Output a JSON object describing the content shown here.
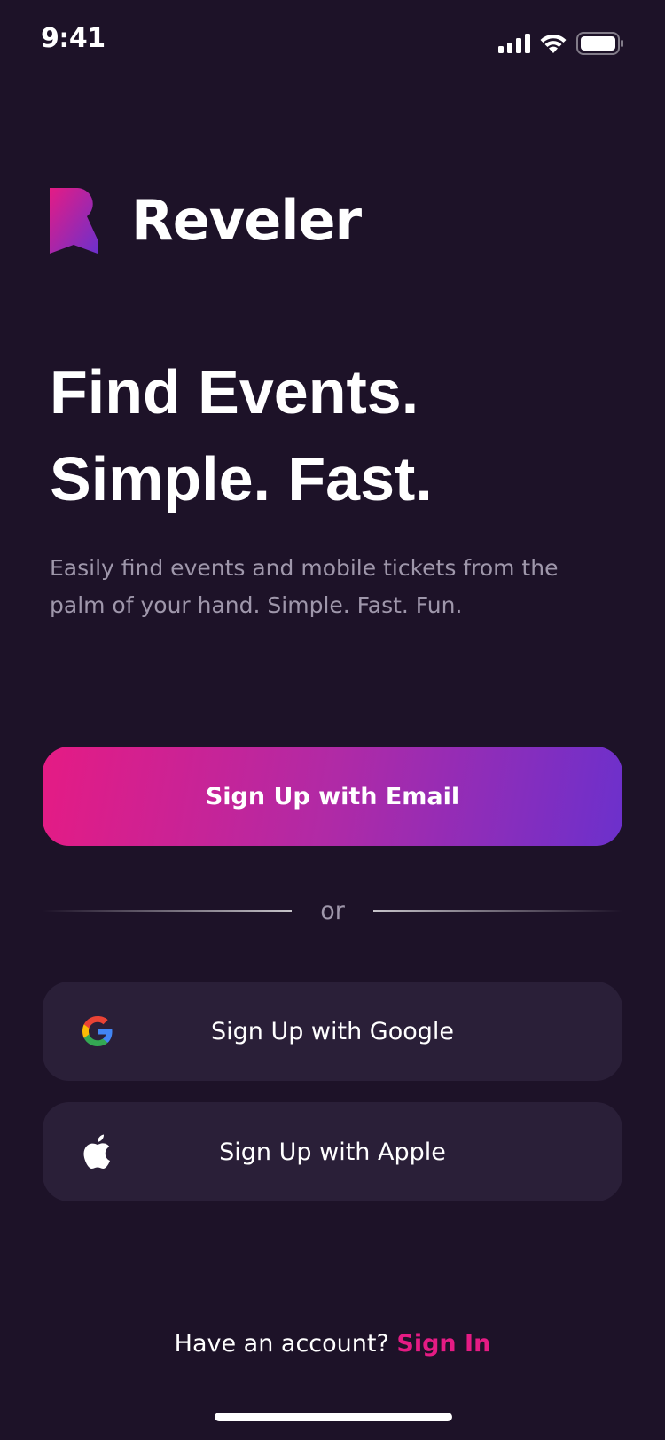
{
  "status_bar": {
    "time": "9:41",
    "signal_icon": "cellular-signal-icon",
    "wifi_icon": "wifi-icon",
    "battery_icon": "battery-icon"
  },
  "brand": {
    "name": "Reveler",
    "logo_icon": "reveler-logo-icon",
    "gradient_start": "#e51b84",
    "gradient_end": "#6c30cc"
  },
  "hero": {
    "headline_line1": "Find Events.",
    "headline_line2": "Simple. Fast.",
    "subtitle": "Easily find events and mobile tickets from the palm of your hand. Simple. Fast. Fun."
  },
  "actions": {
    "email_signup_label": "Sign Up with Email",
    "divider_text": "or",
    "google_signup_label": "Sign Up with Google",
    "google_icon": "google-icon",
    "apple_signup_label": "Sign Up with Apple",
    "apple_icon": "apple-icon"
  },
  "footer": {
    "prompt": "Have an account?",
    "signin_label": "Sign In"
  },
  "colors": {
    "background": "#1d1228",
    "secondary_button": "#2a1f38",
    "accent": "#e51b84",
    "muted_text": "#9f97ab"
  }
}
